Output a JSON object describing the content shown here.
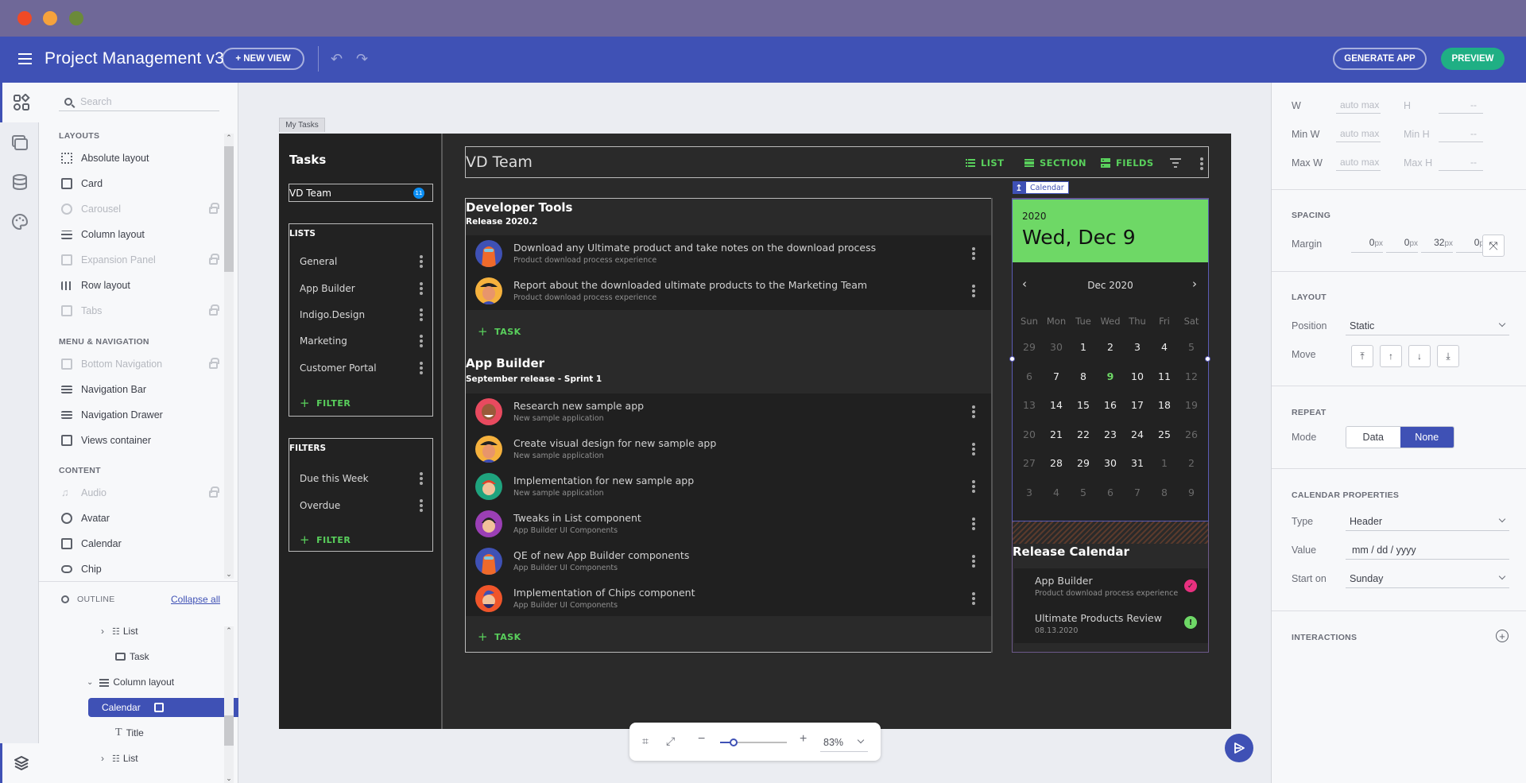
{
  "window": {
    "traffic_lights": [
      {
        "name": "close",
        "color": "#f04a26"
      },
      {
        "name": "minimize",
        "color": "#f5a23c"
      },
      {
        "name": "maximize",
        "color": "#6b8a3a"
      }
    ]
  },
  "appbar": {
    "title": "Project Management v3",
    "new_view_label": "+ NEW VIEW",
    "generate_label": "GENERATE APP",
    "preview_label": "PREVIEW",
    "undo_icon": "undo-icon",
    "redo_icon": "redo-icon",
    "brand_color": "#3f51b5",
    "preview_color": "#1faf84"
  },
  "rail": {
    "items": [
      "components-icon",
      "views-icon",
      "data-icon",
      "theme-icon"
    ],
    "bottom": "layers-icon"
  },
  "components": {
    "search_placeholder": "Search",
    "sections": [
      {
        "title": "LAYOUTS",
        "items": [
          {
            "label": "Absolute layout",
            "locked": false
          },
          {
            "label": "Card",
            "locked": false
          },
          {
            "label": "Carousel",
            "locked": true
          },
          {
            "label": "Column layout",
            "locked": false
          },
          {
            "label": "Expansion Panel",
            "locked": true
          },
          {
            "label": "Row layout",
            "locked": false
          },
          {
            "label": "Tabs",
            "locked": true
          }
        ]
      },
      {
        "title": "MENU & NAVIGATION",
        "items": [
          {
            "label": "Bottom Navigation",
            "locked": true
          },
          {
            "label": "Navigation Bar",
            "locked": false
          },
          {
            "label": "Navigation Drawer",
            "locked": false
          },
          {
            "label": "Views container",
            "locked": false
          }
        ]
      },
      {
        "title": "CONTENT",
        "items": [
          {
            "label": "Audio",
            "locked": true
          },
          {
            "label": "Avatar",
            "locked": false
          },
          {
            "label": "Calendar",
            "locked": false
          },
          {
            "label": "Chip",
            "locked": false
          }
        ]
      }
    ]
  },
  "outline": {
    "title": "OUTLINE",
    "collapse_label": "Collapse all",
    "items": [
      {
        "label": "List",
        "expander": "collapsed"
      },
      {
        "label": "Task",
        "expander": "none"
      },
      {
        "label": "Column layout",
        "expander": "expanded"
      },
      {
        "label": "Calendar",
        "expander": "none",
        "selected": true
      },
      {
        "label": "Title",
        "expander": "none"
      },
      {
        "label": "List",
        "expander": "collapsed"
      }
    ]
  },
  "canvas": {
    "view_tab": "My Tasks",
    "sidebar": {
      "title": "Tasks",
      "team": "VD Team",
      "team_badge": "11",
      "lists_title": "LISTS",
      "lists": [
        "General",
        "App Builder",
        "Indigo.Design",
        "Marketing",
        "Customer Portal"
      ],
      "lists_add": "FILTER",
      "filters_title": "FILTERS",
      "filters": [
        "Due this Week",
        "Overdue"
      ],
      "filters_add": "FILTER"
    },
    "topbar": {
      "title": "VD Team",
      "list_label": "LIST",
      "section_label": "SECTION",
      "fields_label": "FIELDS"
    },
    "groups": [
      {
        "title": "Developer Tools",
        "subtitle": "Release 2020.2",
        "tasks": [
          {
            "title": "Download any Ultimate product and take notes on the download process",
            "sub": "Product download process experience",
            "avatar": "#3f51b5"
          },
          {
            "title": "Report about the downloaded ultimate products to the Marketing Team",
            "sub": "Product download process experience",
            "avatar": "#f5b13d"
          }
        ],
        "add_label": "TASK"
      },
      {
        "title": "App Builder",
        "subtitle": "September release - Sprint 1",
        "tasks": [
          {
            "title": "Research new sample app",
            "sub": "New sample application",
            "avatar": "#e84a5f"
          },
          {
            "title": "Create visual design for new sample app",
            "sub": "New sample application",
            "avatar": "#f5b13d"
          },
          {
            "title": "Implementation for new sample app",
            "sub": "New sample application",
            "avatar": "#1fa37e"
          },
          {
            "title": "Tweaks in List component",
            "sub": "App Builder UI Components",
            "avatar": "#9b3fb5"
          },
          {
            "title": "QE of new App Builder components",
            "sub": "App Builder UI Components",
            "avatar": "#3f51b5"
          },
          {
            "title": "Implementation of Chips component",
            "sub": "App Builder UI Components",
            "avatar": "#f0552a"
          }
        ],
        "add_label": "TASK"
      }
    ],
    "calendar": {
      "selection_label": "Calendar",
      "year": "2020",
      "date": "Wed, Dec 9",
      "month": "Dec 2020",
      "weekdays": [
        "Sun",
        "Mon",
        "Tue",
        "Wed",
        "Thu",
        "Fri",
        "Sat"
      ],
      "weeks": [
        [
          "29",
          "30",
          "1",
          "2",
          "3",
          "4",
          "5"
        ],
        [
          "6",
          "7",
          "8",
          "9",
          "10",
          "11",
          "12"
        ],
        [
          "13",
          "14",
          "15",
          "16",
          "17",
          "18",
          "19"
        ],
        [
          "20",
          "21",
          "22",
          "23",
          "24",
          "25",
          "26"
        ],
        [
          "27",
          "28",
          "29",
          "30",
          "31",
          "1",
          "2"
        ],
        [
          "3",
          "4",
          "5",
          "6",
          "7",
          "8",
          "9"
        ]
      ],
      "selected_day": "9",
      "accent": "#6ed866"
    },
    "release": {
      "title": "Release Calendar",
      "items": [
        {
          "title": "App Builder",
          "sub": "Product download process experience",
          "status": "done",
          "color": "#e8307f"
        },
        {
          "title": "Ultimate Products Review",
          "sub": "08.13.2020",
          "status": "warning",
          "color": "#6ed866"
        }
      ]
    }
  },
  "zoom": {
    "value": "83%",
    "level": 0.2
  },
  "props": {
    "size": [
      {
        "label": "W",
        "value": "auto max",
        "label2": "H",
        "value2": "--"
      },
      {
        "label": "Min W",
        "value": "auto max",
        "label2": "Min H",
        "value2": "--"
      },
      {
        "label": "Max W",
        "value": "auto max",
        "label2": "Max H",
        "value2": "--"
      }
    ],
    "spacing_title": "SPACING",
    "margin_label": "Margin",
    "margin": [
      "0",
      "0",
      "32",
      "0"
    ],
    "unit": "px",
    "layout_title": "LAYOUT",
    "position_label": "Position",
    "position_value": "Static",
    "move_label": "Move",
    "repeat_title": "REPEAT",
    "mode_label": "Mode",
    "mode_options": [
      "Data",
      "None"
    ],
    "mode_selected": "None",
    "calprops_title": "CALENDAR PROPERTIES",
    "type_label": "Type",
    "type_value": "Header",
    "value_label": "Value",
    "value_placeholder": "mm / dd / yyyy",
    "start_label": "Start on",
    "start_value": "Sunday",
    "interactions_title": "INTERACTIONS"
  }
}
